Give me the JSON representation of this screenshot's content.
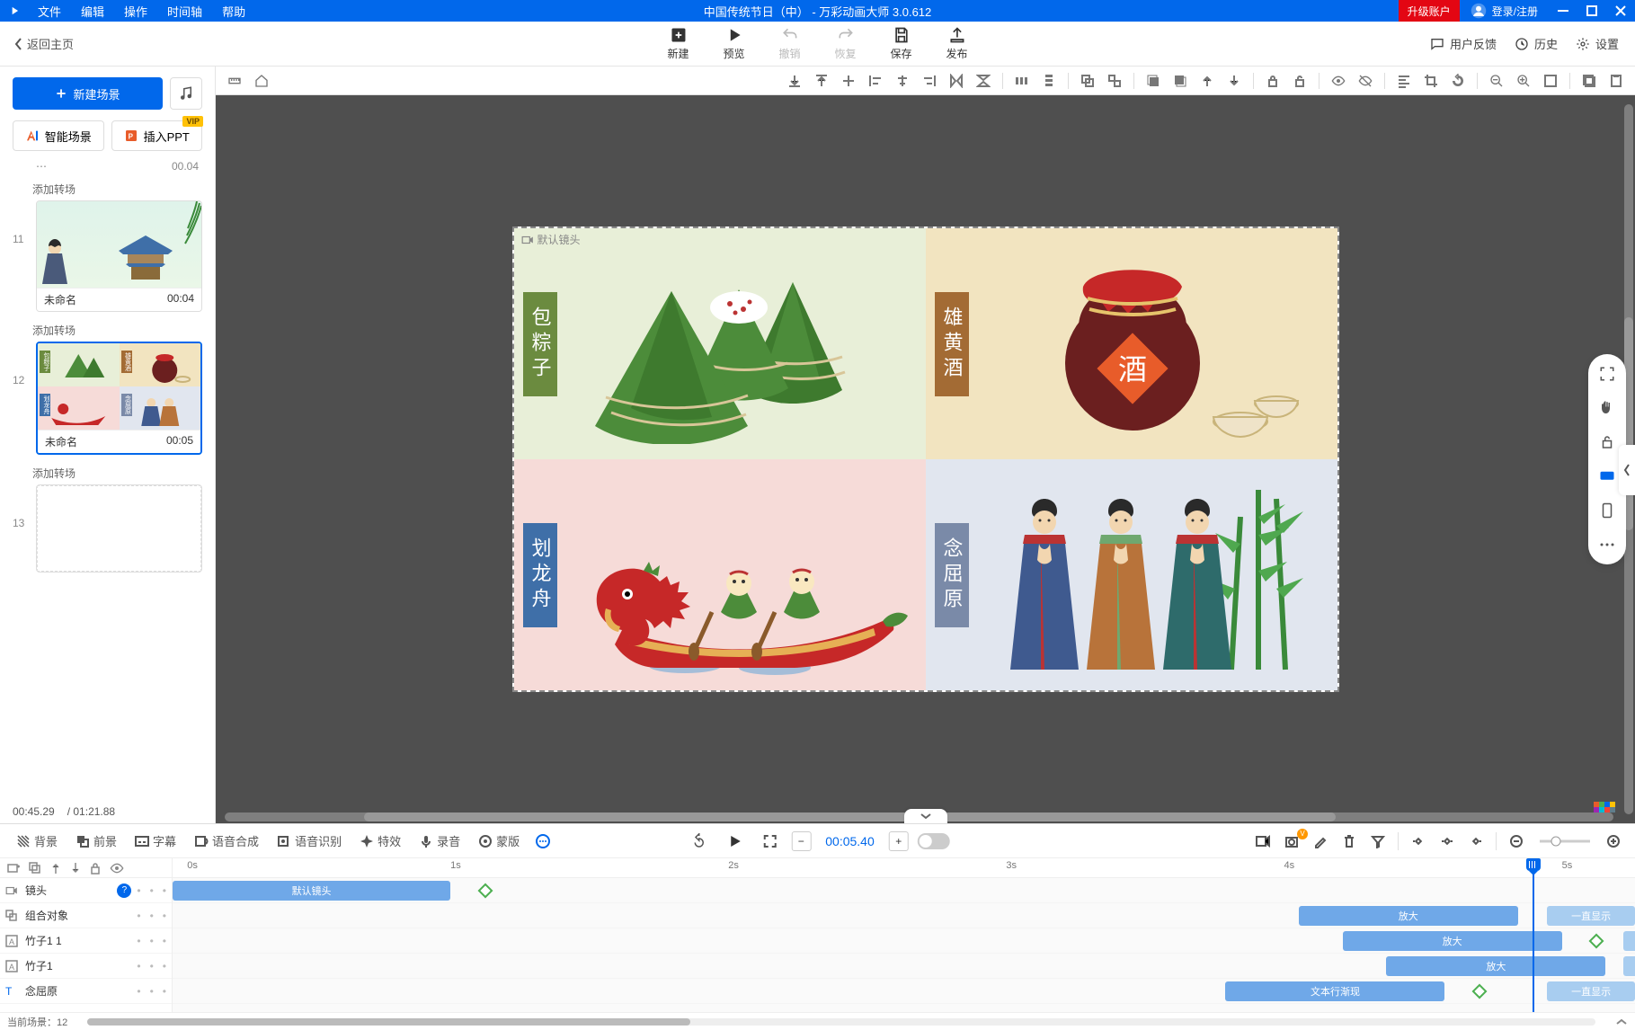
{
  "title": "中国传统节日（中）  - 万彩动画大师 3.0.612",
  "menu": [
    "文件",
    "编辑",
    "操作",
    "时间轴",
    "帮助"
  ],
  "upgrade": "升级账户",
  "login": "登录/注册",
  "back_home": "返回主页",
  "top_actions": {
    "new": "新建",
    "preview": "预览",
    "undo": "撤销",
    "redo": "恢复",
    "save": "保存",
    "publish": "发布"
  },
  "top_right": {
    "feedback": "用户反馈",
    "history": "历史",
    "settings": "设置"
  },
  "left": {
    "new_scene": "新建场景",
    "smart_scene": "智能场景",
    "insert_ppt": "插入PPT",
    "vip": "VIP",
    "add_transition": "添加转场",
    "scenes": [
      {
        "num": "11",
        "name": "未命名",
        "time": "00:04"
      },
      {
        "num": "12",
        "name": "未命名",
        "time": "00:05"
      },
      {
        "num": "13",
        "name": "",
        "time": ""
      }
    ],
    "footer_time1": "00:45.29",
    "footer_time2": "/ 01:21.88",
    "top_partial_time": "00.04"
  },
  "canvas": {
    "default_camera": "默认镜头",
    "labels": {
      "zongzi": "包粽子",
      "wine": "雄黄酒",
      "dragon": "划龙舟",
      "people": "念屈原"
    },
    "jar_char": "酒"
  },
  "timeline": {
    "tools": {
      "bg": "背景",
      "fg": "前景",
      "subtitle": "字幕",
      "tts": "语音合成",
      "asr": "语音识别",
      "fx": "特效",
      "record": "录音",
      "mask": "蒙版"
    },
    "current_time": "00:05.40",
    "ruler": [
      "0s",
      "1s",
      "2s",
      "3s",
      "4s",
      "5s"
    ],
    "rows": [
      {
        "icon": "camera",
        "name": "镜头",
        "help": true
      },
      {
        "icon": "group",
        "name": "组合对象"
      },
      {
        "icon": "text",
        "name": "竹子1 1"
      },
      {
        "icon": "text",
        "name": "竹子1"
      },
      {
        "icon": "T",
        "name": "念屈原"
      }
    ],
    "clips": {
      "default_camera": "默认镜头",
      "zoom_in": "放大",
      "always_show": "一直显示",
      "text_reveal": "文本行渐现"
    },
    "footer_scene": "当前场景：12"
  }
}
